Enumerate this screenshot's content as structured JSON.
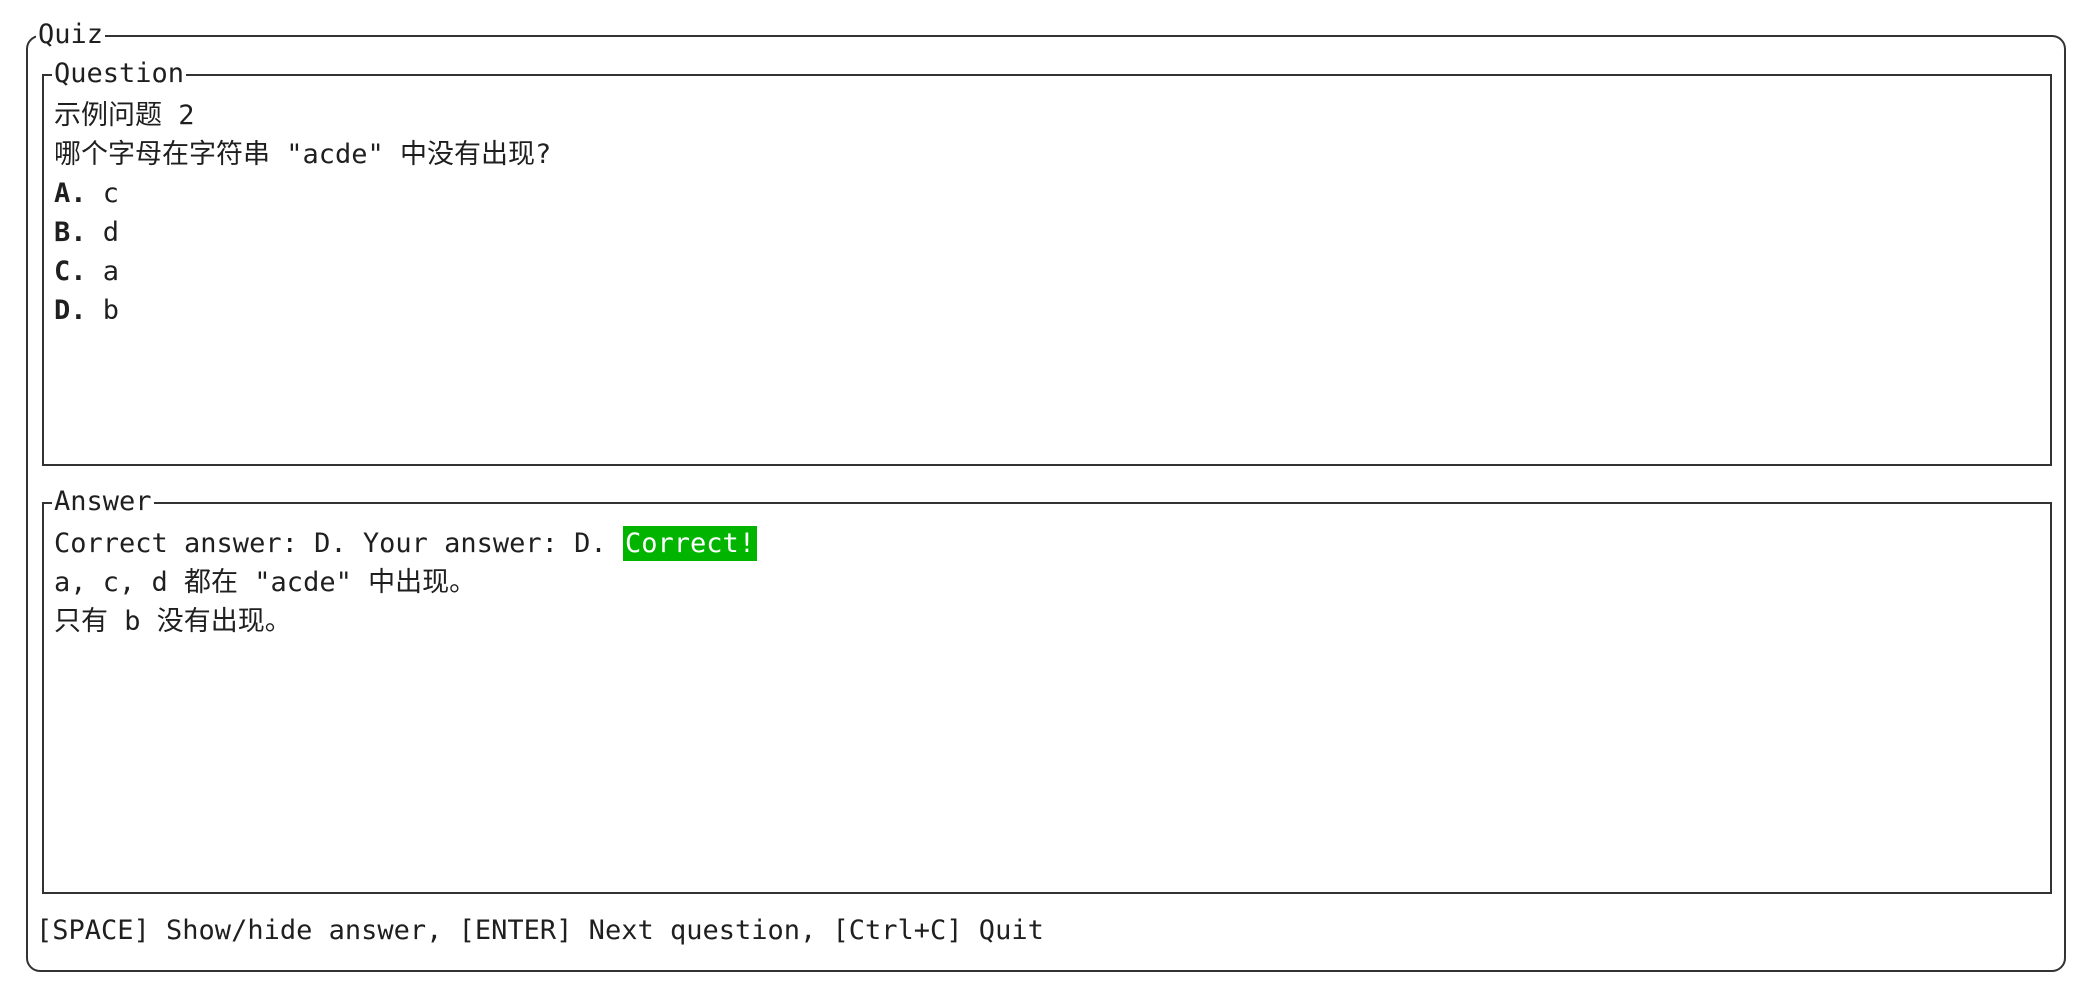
{
  "quiz": {
    "title": "Quiz"
  },
  "question_panel": {
    "title": "Question",
    "heading": "示例问题 2",
    "prompt": "哪个字母在字符串 \"acde\" 中没有出现?",
    "options": [
      {
        "letter": "A.",
        "text": "c"
      },
      {
        "letter": "B.",
        "text": "d"
      },
      {
        "letter": "C.",
        "text": "a"
      },
      {
        "letter": "D.",
        "text": "b"
      }
    ]
  },
  "answer_panel": {
    "title": "Answer",
    "result_line": "Correct answer: D. Your answer: D.",
    "result_badge": "Correct!",
    "result_badge_color": "#00b400",
    "explanation": [
      "a, c, d 都在 \"acde\" 中出现。",
      "只有 b 没有出现。"
    ]
  },
  "footer": {
    "hint": "[SPACE] Show/hide answer, [ENTER] Next question, [Ctrl+C] Quit"
  }
}
